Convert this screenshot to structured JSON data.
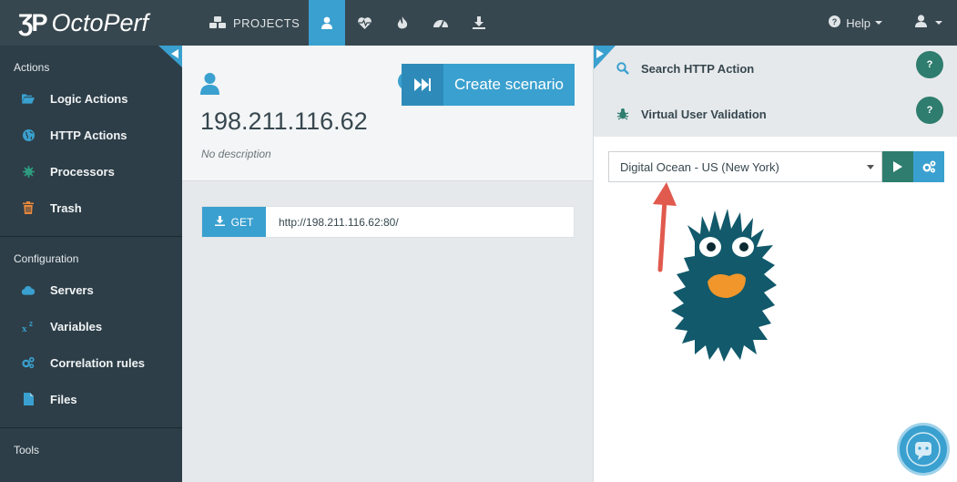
{
  "topbar": {
    "brand": "OctoPerf",
    "nav": [
      {
        "label": "PROJECTS",
        "icon": "cubes-icon"
      },
      {
        "label": "",
        "icon": "user-icon",
        "active": true
      },
      {
        "label": "",
        "icon": "heartbeat-icon"
      },
      {
        "label": "",
        "icon": "fire-icon"
      },
      {
        "label": "",
        "icon": "dashboard-icon"
      },
      {
        "label": "",
        "icon": "download-icon"
      }
    ],
    "help_label": "Help",
    "colors": {
      "bar": "#37474f",
      "active": "#3aa0cf"
    }
  },
  "sidebar": {
    "sections": [
      {
        "title": "Actions",
        "items": [
          {
            "label": "Logic Actions",
            "icon": "folder-open-icon"
          },
          {
            "label": "HTTP Actions",
            "icon": "globe-icon"
          },
          {
            "label": "Processors",
            "icon": "gear-sun-icon"
          },
          {
            "label": "Trash",
            "icon": "trash-icon"
          }
        ]
      },
      {
        "title": "Configuration",
        "items": [
          {
            "label": "Servers",
            "icon": "cloud-icon"
          },
          {
            "label": "Variables",
            "icon": "superscript-icon"
          },
          {
            "label": "Correlation rules",
            "icon": "cogs-icon"
          },
          {
            "label": "Files",
            "icon": "file-icon"
          }
        ]
      },
      {
        "title": "Tools",
        "items": []
      }
    ]
  },
  "main": {
    "vu_name": "198.211.116.62",
    "description": "No description",
    "create_scenario_label": "Create scenario",
    "request": {
      "method": "GET",
      "url": "http://198.211.116.62:80/"
    }
  },
  "right": {
    "items": [
      {
        "label": "Search HTTP Action",
        "icon": "search-icon",
        "help": "?"
      },
      {
        "label": "Virtual User Validation",
        "icon": "bug-icon",
        "help": "?"
      }
    ],
    "location": "Digital Ocean - US (New York)",
    "colors": {
      "green": "#2e7d6e",
      "blue": "#3aa0cf",
      "mascot": "#11596b",
      "beak": "#f0962a",
      "arrow": "#e15a4e"
    }
  }
}
